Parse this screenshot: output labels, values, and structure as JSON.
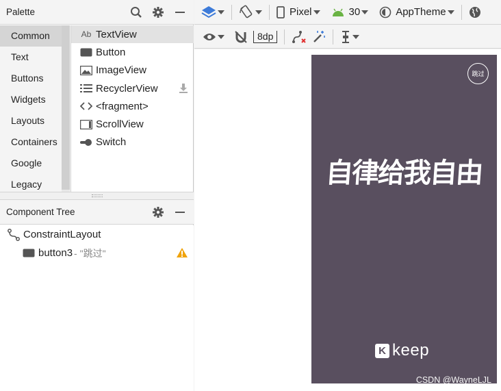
{
  "palette": {
    "title": "Palette",
    "categories": [
      "Common",
      "Text",
      "Buttons",
      "Widgets",
      "Layouts",
      "Containers",
      "Google",
      "Legacy"
    ],
    "items": [
      {
        "label": "TextView",
        "icon": "Ab"
      },
      {
        "label": "Button"
      },
      {
        "label": "ImageView"
      },
      {
        "label": "RecyclerView"
      },
      {
        "label": "<fragment>"
      },
      {
        "label": "ScrollView"
      },
      {
        "label": "Switch"
      }
    ]
  },
  "component_tree": {
    "title": "Component Tree",
    "root": "ConstraintLayout",
    "child": {
      "id": "button3",
      "text": "- \"跳过\""
    }
  },
  "toolbar": {
    "device": "Pixel",
    "api": "30",
    "theme": "AppTheme",
    "margin": "8dp"
  },
  "phone": {
    "skip_label": "跳过",
    "slogan": "自律给我自由",
    "brand_mark": "K",
    "brand_name": "keep",
    "background_color": "#594f5f"
  },
  "watermark": "CSDN @WayneLJL",
  "colors": {
    "accent_blue": "#3d7bd9",
    "android_green": "#6ab344",
    "warning": "#f0a30a"
  }
}
